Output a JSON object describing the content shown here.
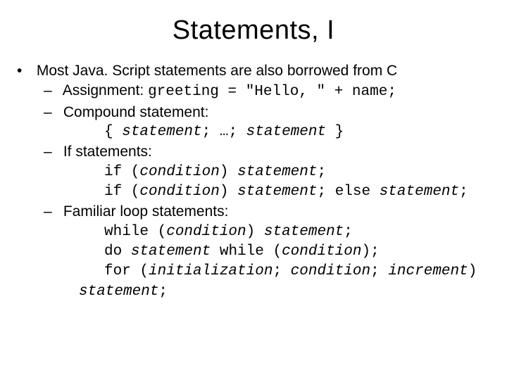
{
  "title": "Statements, I",
  "bullet": {
    "intro": "Most Java. Script statements are also borrowed from C",
    "items": [
      {
        "label": "Assignment: ",
        "code": "greeting = \"Hello, \" + name;"
      },
      {
        "label": "Compound statement:",
        "line1_a": "{ ",
        "line1_b": "statement",
        "line1_c": "; …; ",
        "line1_d": "statement",
        "line1_e": " }"
      },
      {
        "label": "If statements:",
        "if1_a": "if (",
        "if1_b": "condition",
        "if1_c": ") ",
        "if1_d": "statement",
        "if1_e": ";",
        "if2_a": "if (",
        "if2_b": "condition",
        "if2_c": ") ",
        "if2_d": "statement",
        "if2_e": "; else ",
        "if2_f": "statement",
        "if2_g": ";"
      },
      {
        "label": "Familiar loop statements:",
        "w_a": "while (",
        "w_b": "condition",
        "w_c": ") ",
        "w_d": "statement",
        "w_e": ";",
        "d_a": "do ",
        "d_b": "statement",
        "d_c": " while (",
        "d_d": "condition",
        "d_e": ");",
        "f_a": "for (",
        "f_b": "initialization",
        "f_c": "; ",
        "f_d": "condition",
        "f_e": "; ",
        "f_f": "increment",
        "f_g": ")",
        "f_h": "statement",
        "f_i": ";"
      }
    ]
  }
}
